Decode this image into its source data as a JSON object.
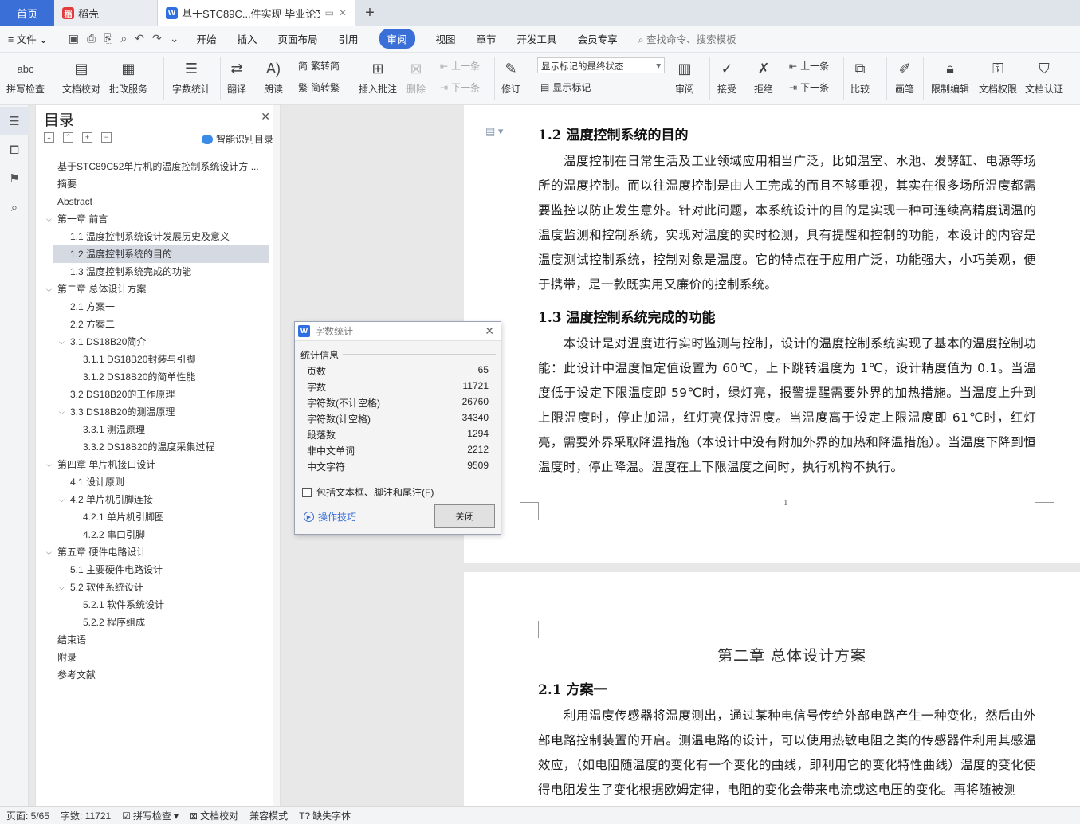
{
  "tabs": {
    "home": "首页",
    "daoke": "稻壳",
    "doc": "基于STC89C...件实现 毕业论文"
  },
  "menu": {
    "file": "文件",
    "items": [
      "开始",
      "插入",
      "页面布局",
      "引用",
      "审阅",
      "视图",
      "章节",
      "开发工具",
      "会员专享"
    ],
    "active": "审阅",
    "search": "查找命令、搜索模板"
  },
  "ribbon": {
    "spell": "拼写检查",
    "doccheck": "文档校对",
    "revise_service": "批改服务",
    "wordcount": "字数统计",
    "translate": "翻译",
    "read": "朗读",
    "trad": "繁转简",
    "simp": "简转繁",
    "insert_comment": "插入批注",
    "delete": "删除",
    "prev": "上一条",
    "next": "下一条",
    "track": "修订",
    "markup_select": "显示标记的最终状态",
    "show_markup": "显示标记",
    "review": "审阅",
    "accept": "接受",
    "reject": "拒绝",
    "prev2": "上一条",
    "next2": "下一条",
    "compare": "比较",
    "pen": "画笔",
    "restrict": "限制编辑",
    "permission": "文档权限",
    "certify": "文档认证"
  },
  "toc": {
    "title": "目录",
    "smart": "智能识别目录",
    "items": [
      {
        "label": "基于STC89C52单片机的温度控制系统设计方 ...",
        "level": 0,
        "arrow": false
      },
      {
        "label": "摘要",
        "level": 0,
        "arrow": false
      },
      {
        "label": "Abstract",
        "level": 0,
        "arrow": false
      },
      {
        "label": "第一章  前言",
        "level": 0,
        "arrow": true
      },
      {
        "label": "1.1  温度控制系统设计发展历史及意义",
        "level": 1,
        "arrow": false
      },
      {
        "label": "1.2  温度控制系统的目的",
        "level": 1,
        "arrow": false,
        "selected": true
      },
      {
        "label": "1.3  温度控制系统完成的功能",
        "level": 1,
        "arrow": false
      },
      {
        "label": "第二章  总体设计方案",
        "level": 0,
        "arrow": true
      },
      {
        "label": "2.1  方案一",
        "level": 1,
        "arrow": false
      },
      {
        "label": "2.2  方案二",
        "level": 1,
        "arrow": false
      },
      {
        "label": "3.1 DS18B20简介",
        "level": 1,
        "arrow": true
      },
      {
        "label": "3.1.1 DS18B20封装与引脚",
        "level": 2,
        "arrow": false
      },
      {
        "label": "3.1.2 DS18B20的简单性能",
        "level": 2,
        "arrow": false
      },
      {
        "label": "3.2 DS18B20的工作原理",
        "level": 1,
        "arrow": false
      },
      {
        "label": "3.3 DS18B20的测温原理",
        "level": 1,
        "arrow": true
      },
      {
        "label": "3.3.1  测温原理",
        "level": 2,
        "arrow": false
      },
      {
        "label": "3.3.2 DS18B20的温度采集过程",
        "level": 2,
        "arrow": false
      },
      {
        "label": "第四章  单片机接口设计",
        "level": 0,
        "arrow": true
      },
      {
        "label": "4.1  设计原则",
        "level": 1,
        "arrow": false
      },
      {
        "label": "4.2  单片机引脚连接",
        "level": 1,
        "arrow": true
      },
      {
        "label": "4.2.1  单片机引脚图",
        "level": 2,
        "arrow": false
      },
      {
        "label": "4.2.2  串口引脚",
        "level": 2,
        "arrow": false
      },
      {
        "label": "第五章  硬件电路设计",
        "level": 0,
        "arrow": true
      },
      {
        "label": "5.1  主要硬件电路设计",
        "level": 1,
        "arrow": false
      },
      {
        "label": "5.2  软件系统设计",
        "level": 1,
        "arrow": true
      },
      {
        "label": "5.2.1  软件系统设计",
        "level": 2,
        "arrow": false
      },
      {
        "label": "5.2.2  程序组成",
        "level": 2,
        "arrow": false
      },
      {
        "label": "结束语",
        "level": 0,
        "arrow": false
      },
      {
        "label": "附录",
        "level": 0,
        "arrow": false
      },
      {
        "label": "参考文献",
        "level": 0,
        "arrow": false
      }
    ]
  },
  "doc": {
    "h12": "1.2 温度控制系统的目的",
    "p12": "温度控制在日常生活及工业领域应用相当广泛，比如温室、水池、发酵缸、电源等场所的温度控制。而以往温度控制是由人工完成的而且不够重视，其实在很多场所温度都需要监控以防止发生意外。针对此问题，本系统设计的目的是实现一种可连续高精度调温的温度监测和控制系统，实现对温度的实时检测，具有提醒和控制的功能，本设计的内容是温度测试控制系统，控制对象是温度。它的特点在于应用广泛，功能强大，小巧美观，便于携带，是一款既实用又廉价的控制系统。",
    "h13": "1.3 温度控制系统完成的功能",
    "p13": "本设计是对温度进行实时监测与控制，设计的温度控制系统实现了基本的温度控制功能：此设计中温度恒定值设置为 60℃，上下跳转温度为 1℃，设计精度值为 0.1。当温度低于设定下限温度即 59℃时，绿灯亮，报警提醒需要外界的加热措施。当温度上升到上限温度时，停止加温，红灯亮保持温度。当温度高于设定上限温度即 61℃时，红灯亮，需要外界采取降温措施（本设计中没有附加外界的加热和降温措施）。当温度下降到恒温度时，停止降温。温度在上下限温度之间时，执行机构不执行。",
    "page_number": "1",
    "chapter2": "第二章  总体设计方案",
    "h21": "2.1 方案一",
    "p21": "利用温度传感器将温度测出，通过某种电信号传给外部电路产生一种变化，然后由外部电路控制装置的开启。测温电路的设计，可以使用热敏电阻之类的传感器件利用其感温效应，（如电阻随温度的变化有一个变化的曲线，即利用它的变化特性曲线）温度的变化使得电阻发生了变化根据欧姆定律，电阻的变化会带来电流或这电压的变化。再将随被测"
  },
  "dialog": {
    "title": "字数统计",
    "group": "统计信息",
    "stats": [
      {
        "label": "页数",
        "value": "65"
      },
      {
        "label": "字数",
        "value": "11721"
      },
      {
        "label": "字符数(不计空格)",
        "value": "26760"
      },
      {
        "label": "字符数(计空格)",
        "value": "34340"
      },
      {
        "label": "段落数",
        "value": "1294"
      },
      {
        "label": "非中文单词",
        "value": "2212"
      },
      {
        "label": "中文字符",
        "value": "9509"
      }
    ],
    "checkbox": "包括文本框、脚注和尾注(F)",
    "tips": "操作技巧",
    "close": "关闭"
  },
  "status": {
    "page": "页面: 5/65",
    "words": "字数: 11721",
    "spell": "拼写检查",
    "doccheck": "文档校对",
    "compat": "兼容模式",
    "missing_font": "缺失字体"
  }
}
